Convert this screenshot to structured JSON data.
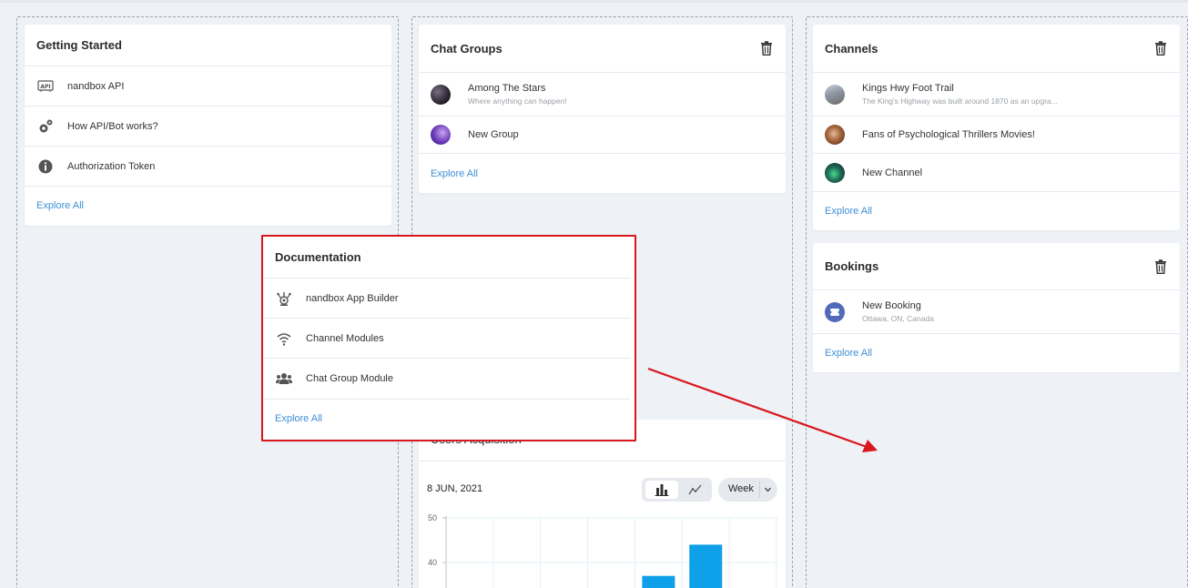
{
  "getting_started": {
    "title": "Getting Started",
    "items": [
      {
        "label": "nandbox API",
        "icon": "api-icon"
      },
      {
        "label": "How API/Bot works?",
        "icon": "gears-icon"
      },
      {
        "label": "Authorization Token",
        "icon": "info-icon"
      }
    ],
    "explore": "Explore All"
  },
  "chat_groups": {
    "title": "Chat Groups",
    "items": [
      {
        "label": "Among The Stars",
        "sub": "Where anything can happen!"
      },
      {
        "label": "New Group",
        "sub": ""
      }
    ],
    "explore": "Explore All"
  },
  "channels": {
    "title": "Channels",
    "items": [
      {
        "label": "Kings Hwy Foot Trail",
        "sub": "The King's Highway was built around 1870 as an upgra..."
      },
      {
        "label": "Fans of Psychological Thrillers Movies!",
        "sub": ""
      },
      {
        "label": "New Channel",
        "sub": ""
      }
    ],
    "explore": "Explore All"
  },
  "bookings": {
    "title": "Bookings",
    "items": [
      {
        "label": "New Booking",
        "sub": "Ottawa, ON, Canada"
      }
    ],
    "explore": "Explore All"
  },
  "documentation": {
    "title": "Documentation",
    "items": [
      {
        "label": "nandbox App Builder",
        "icon": "app-builder-icon"
      },
      {
        "label": "Channel Modules",
        "icon": "wifi-icon"
      },
      {
        "label": "Chat Group Module",
        "icon": "users-icon"
      }
    ],
    "explore": "Explore All"
  },
  "users_acquisition": {
    "title": "Users Acquisition",
    "date": "8 JUN, 2021",
    "period": "Week"
  },
  "chart_data": {
    "type": "bar",
    "ylim": [
      30,
      50
    ],
    "y_ticks": [
      "50",
      "40"
    ],
    "values": [
      null,
      null,
      null,
      null,
      37,
      44,
      null
    ],
    "bar_color": "#0ea0e8"
  },
  "colors": {
    "accent": "#3d8fd6",
    "highlight_border": "#d9171e",
    "arrow": "#d9171e"
  }
}
